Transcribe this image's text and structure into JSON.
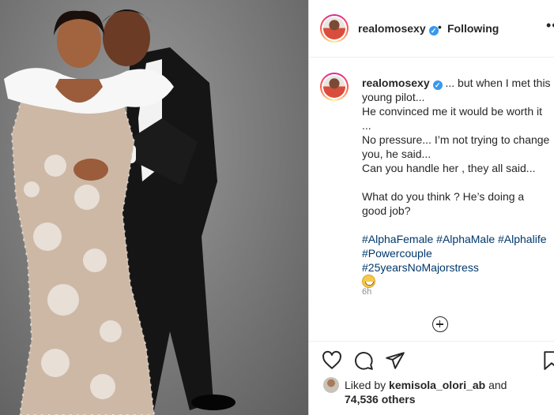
{
  "post": {
    "username": "realomosexy",
    "follow_status": "Following",
    "separator": "•",
    "more_label": "•••",
    "caption_lines": [
      "... but when I met this young pilot...",
      "He convinced me it would be worth it ...",
      "No pressure... I’m not trying to change you, he said...",
      "Can you handle her , they all said...",
      "",
      "What do you think ? He’s doing a good job?"
    ],
    "hashtags": [
      "#AlphaFemale",
      "#AlphaMale",
      "#Alphalife",
      "#Powercouple",
      "#25yearsNoMajorstress"
    ],
    "time_ago": "6h"
  },
  "likes": {
    "prefix": "Liked by",
    "liker": "kemisola_olori_ab",
    "connector": "and",
    "others": "74,536 others"
  },
  "icons": {
    "verified": "verified-badge-icon",
    "like": "heart-icon",
    "comment": "comment-icon",
    "share": "paper-plane-icon",
    "save": "bookmark-icon",
    "add_comment": "plus-circle-icon",
    "emoji": "grinning-sweat-emoji-icon"
  },
  "colors": {
    "hashtag": "#00376b",
    "verified": "#3897f0",
    "muted": "#8e8e8e"
  }
}
